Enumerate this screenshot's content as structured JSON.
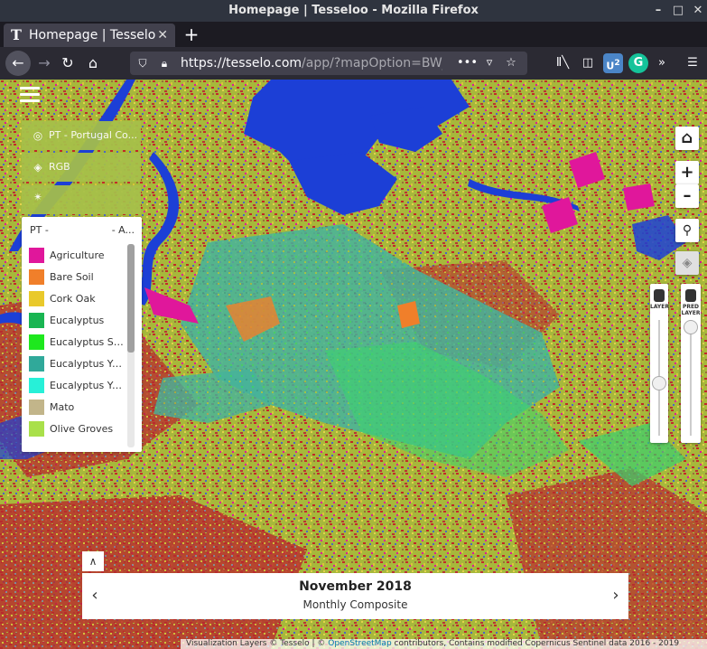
{
  "window": {
    "title": "Homepage | Tesseloo - Mozilla Firefox"
  },
  "tabs": [
    {
      "title": "Homepage | Tesselo"
    }
  ],
  "address_bar": {
    "url_host": "https://tesselo.com",
    "url_path": "/app/?mapOption=BW_C"
  },
  "sidebar": {
    "region_label": "PT - Portugal Co...",
    "rgb_label": "RGB",
    "third_label": ""
  },
  "legend": {
    "header_left": "PT -",
    "header_right": "- A...",
    "items": [
      {
        "label": "Agriculture",
        "color": "#e0179b"
      },
      {
        "label": "Bare Soil",
        "color": "#f07f2a"
      },
      {
        "label": "Cork Oak",
        "color": "#e9c92b"
      },
      {
        "label": "Eucalyptus",
        "color": "#19b552"
      },
      {
        "label": "Eucalyptus Spa...",
        "color": "#1ee81e"
      },
      {
        "label": "Eucalyptus Yo...",
        "color": "#30a99a"
      },
      {
        "label": "Eucalyptus Yo...",
        "color": "#27f0d8"
      },
      {
        "label": "Mato",
        "color": "#c2b58a"
      },
      {
        "label": "Olive Groves",
        "color": "#a9e04a"
      }
    ]
  },
  "sliders": [
    {
      "label": "LAYER",
      "value": 0.55
    },
    {
      "label": "PRED LAYER",
      "value": 0.0
    }
  ],
  "timebar": {
    "title": "November 2018",
    "subtitle": "Monthly Composite"
  },
  "attribution": {
    "prefix": "Visualization Layers © Tesselo | ©",
    "osm_link": "OpenStreetMap",
    "suffix": "contributors, Contains modified Copernicus Sentinel data 2016 - 2019"
  },
  "colors": {
    "water": "#1c3fd6",
    "map_base": "#9fb83a",
    "panel_green": "#a6c04a"
  }
}
